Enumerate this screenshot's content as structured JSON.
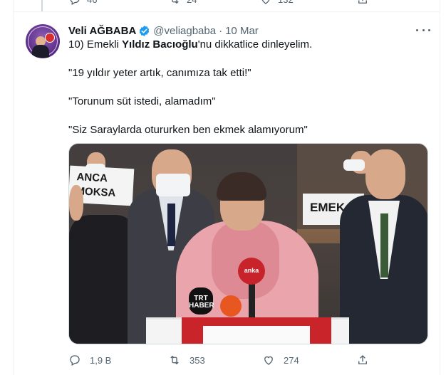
{
  "previous_tweet": {
    "reply_count": "46",
    "retweet_count": "24",
    "like_count": "132"
  },
  "tweet": {
    "author_name": "Veli AĞBABA",
    "handle": "@veliagbaba",
    "separator": "·",
    "date": "10 Mar",
    "line1_prefix": "10) Emekli ",
    "line1_bold": "Yıldız Bacıoğlu",
    "line1_suffix": "'nu dikkatlice dinleyelim.",
    "quote1": "\"19 yıldır yeter artık, canımıza tak etti!\"",
    "quote2": "\"Torunum süt istedi, alamadım\"",
    "quote3": "\"Siz Saraylarda otururken ben ekmek alamıyorum\"",
    "media": {
      "sign_left": "ANCA\nMOKSA",
      "sign_right": "EMEK",
      "mic_trt": "TRT\nHABER",
      "mic_anka": "anka"
    },
    "actions": {
      "reply_count": "1,9 B",
      "retweet_count": "353",
      "like_count": "274"
    }
  },
  "colors": {
    "verified_blue": "#1d9bf0",
    "secondary_text": "#536471",
    "primary_text": "#0f1419",
    "divider": "#eff3f4"
  }
}
